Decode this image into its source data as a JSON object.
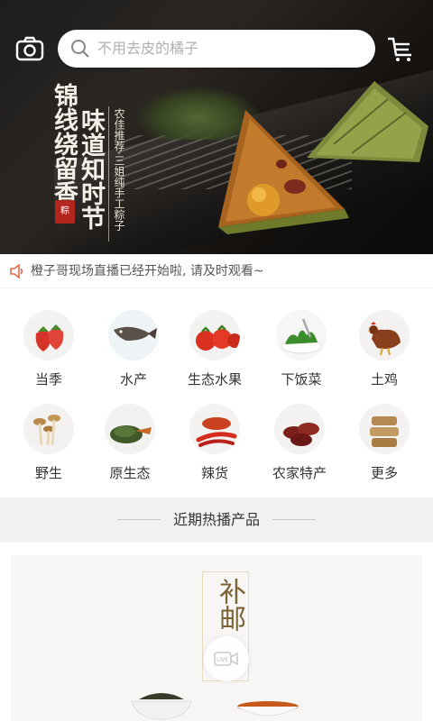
{
  "header": {
    "search_placeholder": "不用去皮的橘子"
  },
  "banner": {
    "title_line1": "锦线绕留香",
    "title_line2": "味道知时节",
    "seal_text": "粽",
    "subtitle": "农佳推荐·三姐纯手工粽子"
  },
  "notice": {
    "text": "橙子哥现场直播已经开始啦, 请及时观看~"
  },
  "categories": [
    {
      "label": "当季",
      "icon": "strawberry-icon"
    },
    {
      "label": "水产",
      "icon": "fish-icon"
    },
    {
      "label": "生态水果",
      "icon": "tomato-icon"
    },
    {
      "label": "下饭菜",
      "icon": "seaweed-icon"
    },
    {
      "label": "土鸡",
      "icon": "chicken-icon"
    },
    {
      "label": "野生",
      "icon": "mushroom-icon"
    },
    {
      "label": "原生态",
      "icon": "tea-leaves-icon"
    },
    {
      "label": "辣货",
      "icon": "chili-icon"
    },
    {
      "label": "农家特产",
      "icon": "dates-icon"
    },
    {
      "label": "更多",
      "icon": "more-icon"
    }
  ],
  "section": {
    "heading": "近期热播产品"
  },
  "product": {
    "banner_text": "补邮"
  }
}
